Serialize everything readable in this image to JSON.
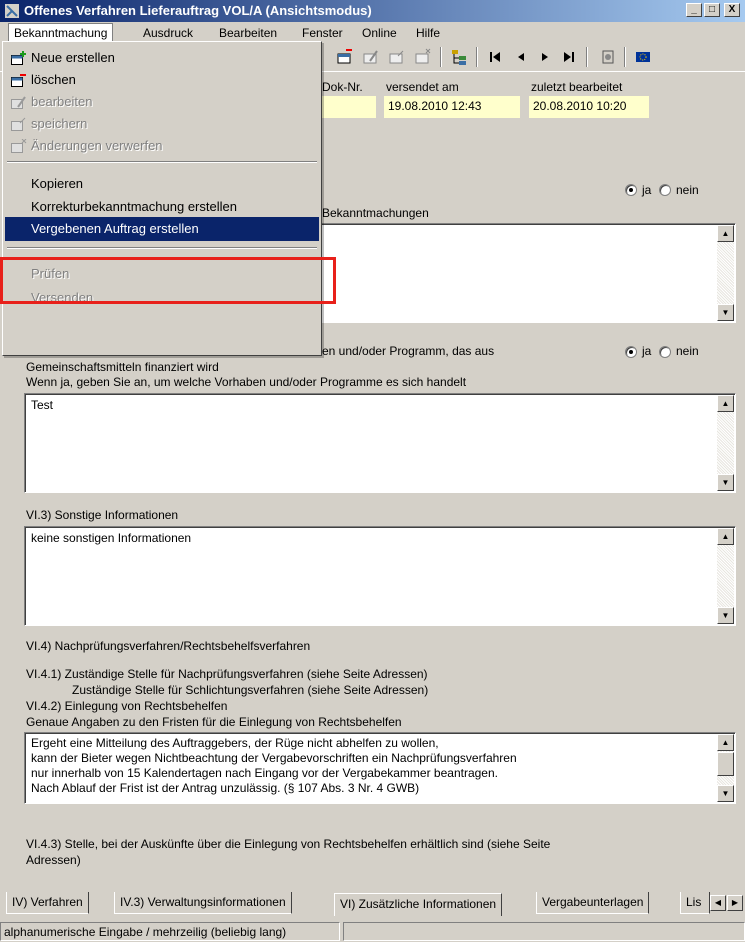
{
  "window": {
    "title": "Offenes Verfahren Lieferauftrag VOL/A (Ansichtsmodus)",
    "caption_buttons": [
      "_",
      "□",
      "X"
    ]
  },
  "menubar": {
    "items": [
      {
        "label": "Bekanntmachung",
        "open": true
      },
      {
        "label": "Ausdruck"
      },
      {
        "label": "Bearbeiten"
      },
      {
        "label": "Fenster"
      },
      {
        "label": "Online"
      },
      {
        "label": "Hilfe"
      }
    ]
  },
  "dropdown": {
    "items": [
      {
        "label": "Neue erstellen",
        "icon": "new-document-icon",
        "enabled": true
      },
      {
        "label": "löschen",
        "icon": "delete-document-icon",
        "enabled": true
      },
      {
        "label": "bearbeiten",
        "icon": "edit-document-icon",
        "enabled": false
      },
      {
        "label": "speichern",
        "icon": "save-document-icon",
        "enabled": false
      },
      {
        "label": "Änderungen verwerfen",
        "icon": "discard-changes-icon",
        "enabled": false
      },
      {
        "label": "Kopieren",
        "enabled": true
      },
      {
        "label": "Korrekturbekanntmachung erstellen",
        "enabled": true
      },
      {
        "label": "Vergebenen Auftrag erstellen",
        "enabled": true,
        "selected": true
      },
      {
        "label": "Prüfen",
        "enabled": false
      },
      {
        "label": "Versenden",
        "enabled": false
      }
    ]
  },
  "header": {
    "doknr_label": "Dok-Nr.",
    "versendet_label": "versendet am",
    "versendet_value": "19.08.2010 12:43",
    "bearbeitet_label": "zuletzt bearbeitet",
    "bearbeitet_value": "20.08.2010 10:20"
  },
  "section1": {
    "radio_yes": "ja",
    "radio_no": "nein",
    "label_tail": "Bekanntmachungen",
    "text": ""
  },
  "section2": {
    "label_line1_tail": "en und/oder Programm, das aus",
    "label_line2": "Gemeinschaftsmitteln finanziert wird",
    "radio_yes": "ja",
    "radio_no": "nein",
    "question": "Wenn ja, geben Sie an, um welche Vorhaben und/oder Programme es sich handelt",
    "text": "Test"
  },
  "section3": {
    "label": "VI.3) Sonstige Informationen",
    "text": "keine sonstigen Informationen"
  },
  "section4": {
    "heading": "VI.4) Nachprüfungsverfahren/Rechtsbehelfsverfahren",
    "line1": "VI.4.1) Zuständige Stelle für Nachprüfungsverfahren (siehe Seite Adressen)",
    "line2": "Zuständige Stelle für Schlichtungsverfahren (siehe Seite Adressen)",
    "line3": "VI.4.2) Einlegung von Rechtsbehelfen",
    "line4": "Genaue Angaben zu den Fristen für die Einlegung von Rechtsbehelfen",
    "text": "Ergeht eine Mitteilung des Auftraggebers, der Rüge nicht abhelfen zu wollen,\nkann der Bieter wegen Nichtbeachtung der Vergabevorschriften ein Nachprüfungsverfahren\nnur innerhalb von 15 Kalendertagen nach Eingang vor der Vergabekammer beantragen.\nNach Ablauf der Frist ist der Antrag unzulässig. (§ 107 Abs. 3 Nr. 4 GWB)",
    "line5a": "VI.4.3) Stelle, bei der Auskünfte über die Einlegung von Rechtsbehelfen erhältlich sind (siehe Seite",
    "line5b": "Adressen)"
  },
  "tabs": [
    {
      "label": "IV) Verfahren"
    },
    {
      "label": "IV.3) Verwaltungsinformationen"
    },
    {
      "label": "VI) Zusätzliche Informationen",
      "active": true
    },
    {
      "label": "Vergabeunterlagen"
    },
    {
      "label": "Lis"
    }
  ],
  "statusbar": {
    "text": "alphanumerische Eingabe / mehrzeilig (beliebig lang)"
  },
  "colors": {
    "selection": "#0a246a",
    "highlight_box": "#e8201a",
    "field_bg": "#ffffcc"
  }
}
